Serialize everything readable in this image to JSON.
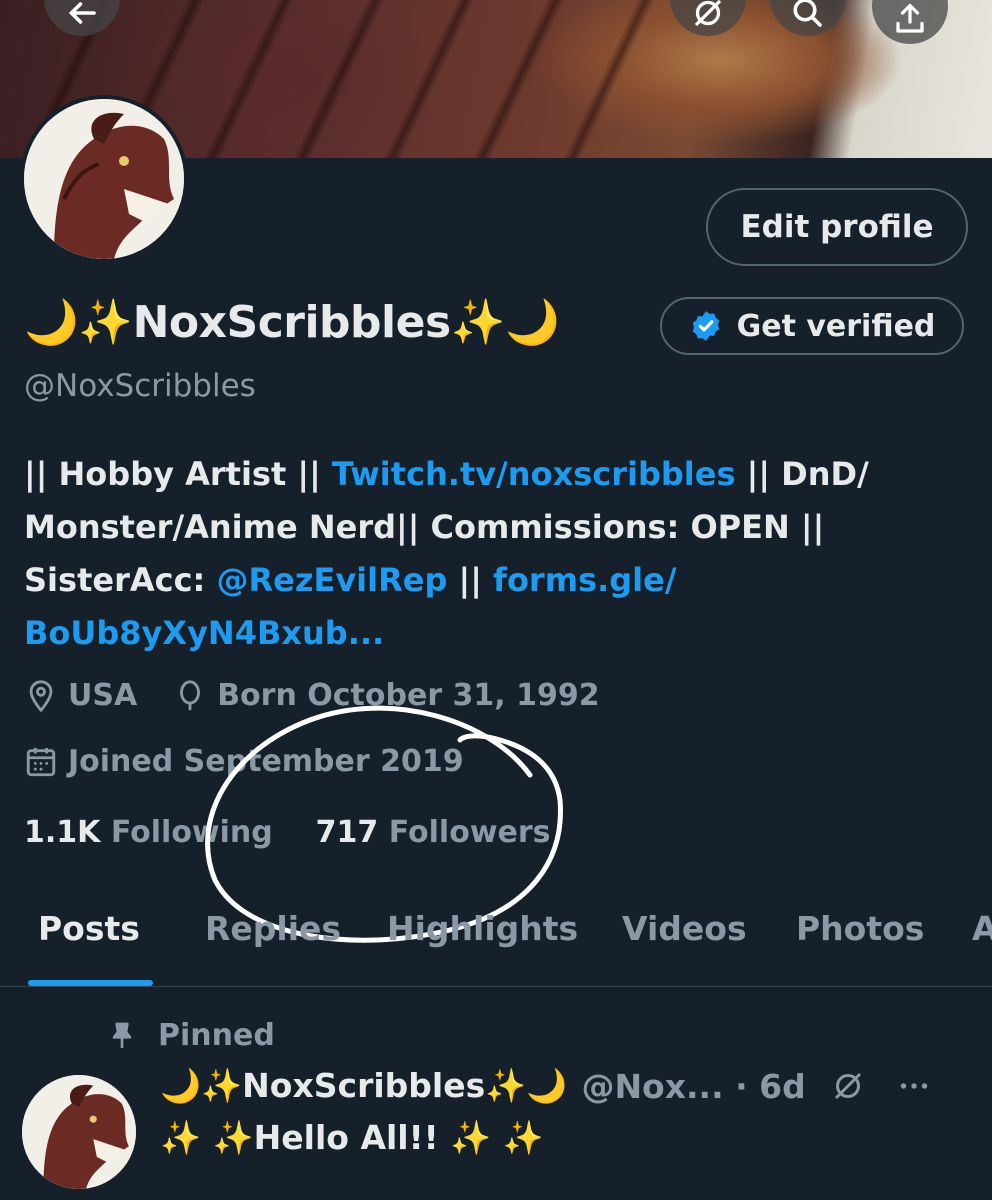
{
  "profile": {
    "display_name": "🌙✨NoxScribbles✨🌙",
    "handle": "@NoxScribbles",
    "edit_profile_label": "Edit profile",
    "get_verified_label": "Get verified",
    "bio": {
      "part1": "|| Hobby Artist || ",
      "link1": "Twitch.tv/noxscribbles",
      "part2": " || DnD/ Monster/Anime Nerd|| Commissions: OPEN || SisterAcc: ",
      "link2": "@RezEvilRep",
      "part3": " || ",
      "link3": "forms.gle/ BoUb8yXyN4Bxub..."
    },
    "location": "USA",
    "born": "Born October 31, 1992",
    "joined": "Joined September 2019",
    "following_count": "1.1K",
    "following_label": "Following",
    "followers_count": "717",
    "followers_label": "Followers"
  },
  "tabs": [
    "Posts",
    "Replies",
    "Highlights",
    "Videos",
    "Photos",
    "A"
  ],
  "active_tab": "Posts",
  "pinned_post": {
    "pinned_label": "Pinned",
    "name": "🌙✨NoxScribbles✨🌙",
    "handle_time": "@Nox... · 6d",
    "text": "✨ ✨Hello All!! ✨ ✨"
  },
  "colors": {
    "background": "#15202b",
    "accent": "#1d9bf0",
    "secondary_text": "#8b98a5",
    "border": "#536471"
  },
  "icons": [
    "back-arrow-icon",
    "grok-icon",
    "search-icon",
    "share-icon",
    "verified-badge-icon",
    "location-icon",
    "balloon-icon",
    "calendar-icon",
    "pin-icon",
    "grok-small-icon",
    "more-icon"
  ]
}
